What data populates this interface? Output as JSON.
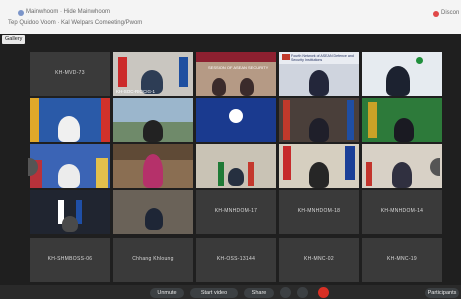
{
  "window": {
    "title": "Mainwhoom  ·  Hide Mainwhoom",
    "subtitle": "Tep Quidoo Voom  ·  Kal Welpars Comeeting/Pwom",
    "record_label": "Discon"
  },
  "meeting": {
    "view_badge": "Gallery"
  },
  "tiles": [
    "KH-MVD-73",
    "KH-SOC-RIOCIG-1",
    "SESSION OF ASEAN SECURITY",
    "Fourth Network of ASEAN Defence and Security Institutions",
    "",
    "",
    "",
    "",
    "",
    "",
    "",
    "",
    "",
    "",
    "",
    "",
    "",
    "KH-MNHDOM-17",
    "KH-MNHDOM-18",
    "KH-MNHDOM-14",
    "KH-SHMBOSS-06",
    "Chhang Khloung",
    "KH-OSS-13144",
    "KH-MNC-02",
    "KH-MNC-19"
  ],
  "controls": {
    "unmute": "Unmute",
    "start_video": "Start video",
    "share": "Share",
    "participants": "Participants"
  }
}
